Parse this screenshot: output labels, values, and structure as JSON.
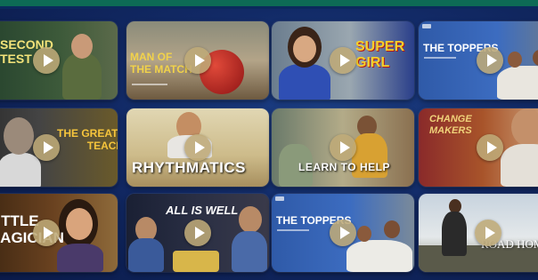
{
  "cards": [
    {
      "title": "SECOND\nTEST"
    },
    {
      "title": "MAN OF\nTHE MATCH"
    },
    {
      "title": "SUPER\nGIRL"
    },
    {
      "title": "THE TOPPERS"
    },
    {
      "title": "THE GREATEST\nTEACHER"
    },
    {
      "title": "RHYTHMATICS"
    },
    {
      "title": "LEARN TO HELP"
    },
    {
      "title": "CHANGE\nMAKERS"
    },
    {
      "title": "LITTLE\nMAGICIAN"
    },
    {
      "title": "ALL IS WELL"
    },
    {
      "title": "THE TOPPERS"
    },
    {
      "title": "ROAD HOME"
    }
  ],
  "colors": {
    "background": "#122a66",
    "play_button": "#bea878",
    "top_bar": "#0d6b55"
  }
}
